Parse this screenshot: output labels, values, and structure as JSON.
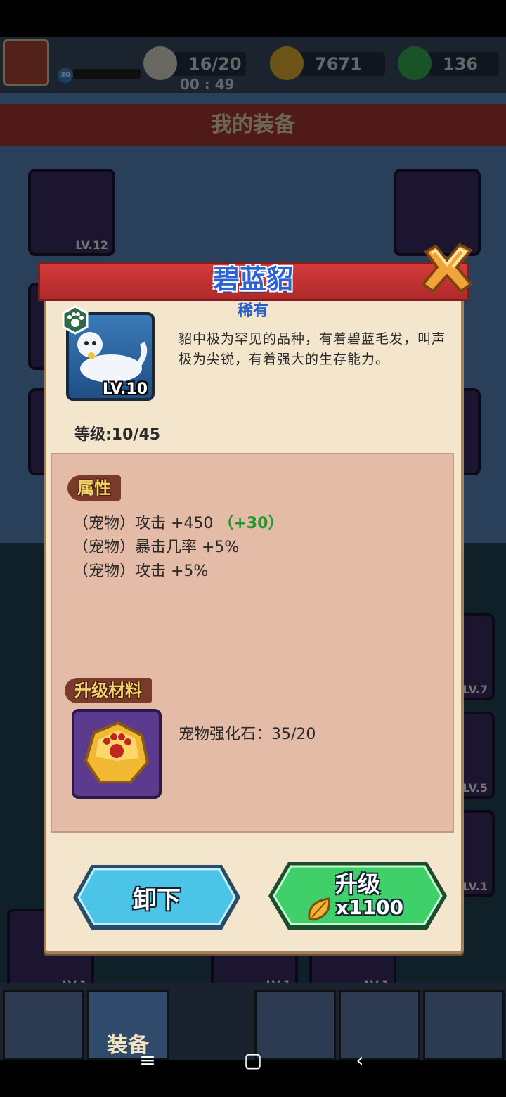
{
  "hud": {
    "stamina": "16/20",
    "stamina_timer": "00 : 49",
    "gold": "7671",
    "gems": "136",
    "player_level": "30"
  },
  "screen_title": "我的装备",
  "background_cards": [
    {
      "level": "LV.12"
    },
    {
      "level": "LV.7"
    },
    {
      "level": "LV.5"
    },
    {
      "level": "LV.1"
    },
    {
      "level": "LV.1"
    },
    {
      "level": "LV.1"
    },
    {
      "level": "LV.1"
    }
  ],
  "bottom_nav": {
    "active_label": "装备"
  },
  "modal": {
    "title": "碧蓝貂",
    "rarity": "稀有",
    "pet_level": "LV.10",
    "description": "貂中极为罕见的品种，有着碧蓝毛发，叫声极为尖锐，有着强大的生存能力。",
    "level_progress": "等级:10/45",
    "attributes_header": "属性",
    "attributes": [
      {
        "text": "（宠物）攻击 +450",
        "bonus": "（+30）"
      },
      {
        "text": "（宠物）暴击几率 +5%",
        "bonus": ""
      },
      {
        "text": "（宠物）攻击 +5%",
        "bonus": ""
      }
    ],
    "materials_header": "升级材料",
    "material_text": "宠物强化石：35/20",
    "unequip_label": "卸下",
    "upgrade_label": "升级",
    "upgrade_cost": "x1100"
  },
  "colors": {
    "ribbon_red": "#c22f2f",
    "title_blue": "#2b63d6",
    "bonus_green": "#1f9a2a",
    "panel_pink": "#e3bba6",
    "button_blue": "#4cc4e8",
    "button_green": "#3fd06a"
  }
}
